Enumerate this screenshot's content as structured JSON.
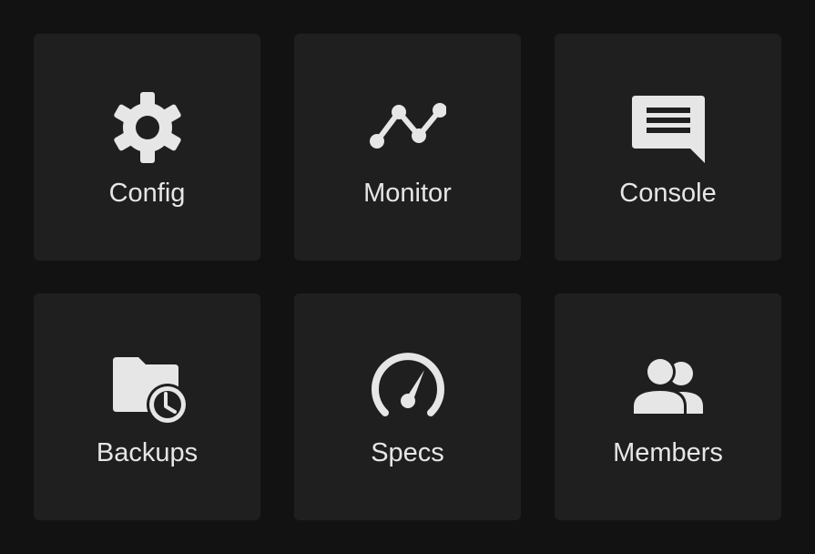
{
  "tiles": [
    {
      "label": "Config",
      "icon": "gear-icon"
    },
    {
      "label": "Monitor",
      "icon": "line-chart-icon"
    },
    {
      "label": "Console",
      "icon": "message-icon"
    },
    {
      "label": "Backups",
      "icon": "folder-clock-icon"
    },
    {
      "label": "Specs",
      "icon": "speedometer-icon"
    },
    {
      "label": "Members",
      "icon": "group-icon"
    }
  ],
  "colors": {
    "background": "#121212",
    "tile": "#1f1f1f",
    "foreground": "#e6e6e6"
  }
}
